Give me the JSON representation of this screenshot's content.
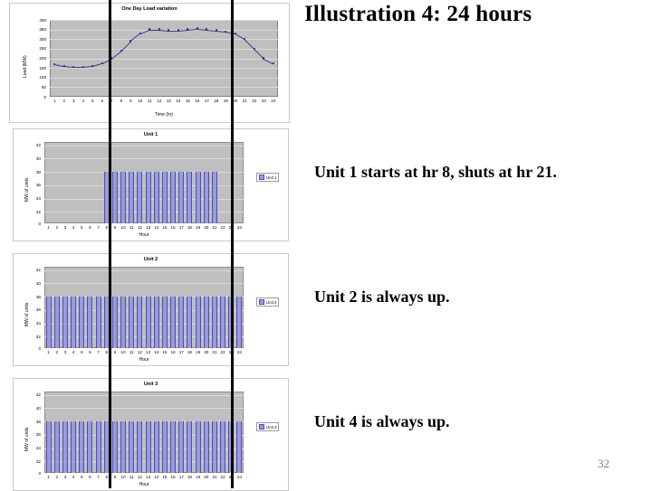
{
  "slide": {
    "title": "Illustration 4: 24 hours",
    "page_number": "32",
    "captions": [
      "Unit 1 starts at hr 8, shuts at hr 21.",
      "Unit 2 is always up.",
      "Unit 4 is always up."
    ]
  },
  "chart_data": [
    {
      "type": "line",
      "title": "One Day Load variation",
      "xlabel": "Time (hr)",
      "ylabel": "Load (MW)",
      "x": [
        1,
        2,
        3,
        4,
        5,
        6,
        7,
        8,
        9,
        10,
        11,
        12,
        13,
        14,
        15,
        16,
        17,
        18,
        19,
        20,
        21,
        22,
        23,
        24
      ],
      "categories": [
        "1",
        "2",
        "3",
        "4",
        "5",
        "6",
        "7",
        "8",
        "9",
        "10",
        "11",
        "12",
        "13",
        "14",
        "15",
        "16",
        "17",
        "18",
        "19",
        "20",
        "21",
        "22",
        "23",
        "24"
      ],
      "values": [
        170,
        160,
        155,
        155,
        160,
        175,
        200,
        240,
        290,
        330,
        350,
        350,
        345,
        345,
        350,
        355,
        350,
        345,
        340,
        330,
        300,
        250,
        200,
        175
      ],
      "ytick_labels": [
        "0",
        "50",
        "100",
        "150",
        "200",
        "250",
        "300",
        "350",
        "400"
      ],
      "ylim": [
        0,
        400
      ],
      "grid": true,
      "legend": ""
    },
    {
      "type": "bar",
      "title": "Unit 1",
      "xlabel": "Hour",
      "ylabel": "MW of units",
      "categories": [
        "1",
        "2",
        "3",
        "4",
        "5",
        "6",
        "7",
        "8",
        "9",
        "10",
        "11",
        "12",
        "13",
        "14",
        "15",
        "16",
        "17",
        "18",
        "19",
        "20",
        "21",
        "22",
        "23",
        "24"
      ],
      "values": [
        0,
        0,
        0,
        0,
        0,
        0,
        0,
        38,
        38,
        38,
        38,
        38,
        38,
        38,
        38,
        38,
        38,
        38,
        38,
        38,
        38,
        0,
        0,
        0
      ],
      "ytick_labels": [
        "0",
        "32",
        "34",
        "36",
        "38",
        "40",
        "42"
      ],
      "ylim": [
        0,
        42
      ],
      "legend": "Unit 1",
      "legend_position": "right",
      "grid": true
    },
    {
      "type": "bar",
      "title": "Unit 2",
      "xlabel": "Hour",
      "ylabel": "MW of units",
      "categories": [
        "1",
        "2",
        "3",
        "4",
        "5",
        "6",
        "7",
        "8",
        "9",
        "10",
        "11",
        "12",
        "13",
        "14",
        "15",
        "16",
        "17",
        "18",
        "19",
        "20",
        "21",
        "22",
        "23",
        "24"
      ],
      "values": [
        38,
        38,
        38,
        38,
        38,
        38,
        38,
        38,
        38,
        38,
        38,
        38,
        38,
        38,
        38,
        38,
        38,
        38,
        38,
        38,
        38,
        38,
        38,
        38
      ],
      "ytick_labels": [
        "0",
        "32",
        "34",
        "36",
        "38",
        "40",
        "42"
      ],
      "ylim": [
        0,
        42
      ],
      "legend": "Unit 2",
      "legend_position": "right",
      "grid": true
    },
    {
      "type": "bar",
      "title": "Unit 3",
      "xlabel": "Hour",
      "ylabel": "MW of units",
      "categories": [
        "1",
        "2",
        "3",
        "4",
        "5",
        "6",
        "7",
        "8",
        "9",
        "10",
        "11",
        "12",
        "13",
        "14",
        "15",
        "16",
        "17",
        "18",
        "19",
        "20",
        "21",
        "22",
        "23",
        "24"
      ],
      "values": [
        38,
        38,
        38,
        38,
        38,
        38,
        38,
        38,
        38,
        38,
        38,
        38,
        38,
        38,
        38,
        38,
        38,
        38,
        38,
        38,
        38,
        38,
        38,
        38
      ],
      "ytick_labels": [
        "0",
        "32",
        "34",
        "36",
        "38",
        "40",
        "42"
      ],
      "ylim": [
        0,
        42
      ],
      "legend": "Unit 3",
      "legend_position": "right",
      "grid": true
    }
  ]
}
